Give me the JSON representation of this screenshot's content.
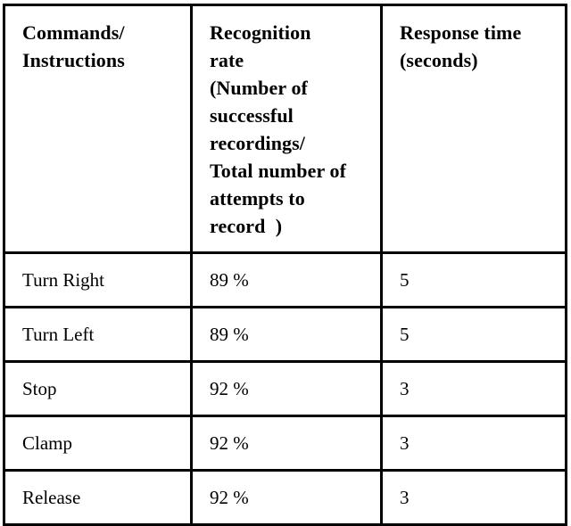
{
  "table": {
    "columns": [
      {
        "key": "command",
        "header_lines": [
          "Commands/",
          "Instructions"
        ]
      },
      {
        "key": "recognition_rate",
        "header_lines": [
          "Recognition",
          "rate",
          "(Number of",
          "successful",
          "recordings/",
          "Total number of",
          "attempts to",
          "record  )"
        ]
      },
      {
        "key": "response_time",
        "header_lines": [
          "Response time",
          "(seconds)"
        ]
      }
    ],
    "rows": [
      {
        "command": "Turn Right",
        "recognition_rate": "89 %",
        "response_time": "5"
      },
      {
        "command": "Turn Left",
        "recognition_rate": "89 %",
        "response_time": "5"
      },
      {
        "command": "Stop",
        "recognition_rate": "92 %",
        "response_time": "3"
      },
      {
        "command": "Clamp",
        "recognition_rate": "92 %",
        "response_time": "3"
      },
      {
        "command": "Release",
        "recognition_rate": "92 %",
        "response_time": "3"
      }
    ]
  },
  "colors": {
    "border": "#000000",
    "text": "#000000",
    "background": "#ffffff"
  }
}
